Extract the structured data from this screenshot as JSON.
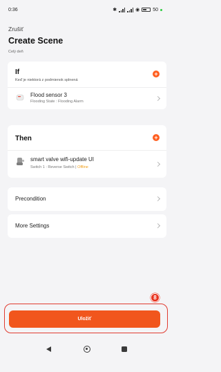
{
  "status_bar": {
    "time": "0:36",
    "battery": "50"
  },
  "header": {
    "cancel_label": "Zrušiť",
    "title": "Create Scene",
    "subtitle": "Celý deň"
  },
  "if_section": {
    "title": "If",
    "hint": "Keď je niektorá z podmienok splnená",
    "conditions": [
      {
        "name": "Flood sensor 3",
        "detail": "Flooding State : Flooding Alarm",
        "icon": "flood-sensor-icon"
      }
    ]
  },
  "then_section": {
    "title": "Then",
    "actions": [
      {
        "name": "smart valve wifi-update UI",
        "detail": "Switch 1 : Reverse Switch | ",
        "status": "Offline",
        "icon": "smart-valve-icon"
      }
    ]
  },
  "precondition_label": "Precondition",
  "more_settings_label": "More Settings",
  "save_label": "Uložiť",
  "step_badge": "8",
  "colors": {
    "accent": "#f1561d",
    "highlight": "#e03a2f",
    "offline": "#f0a01d"
  }
}
